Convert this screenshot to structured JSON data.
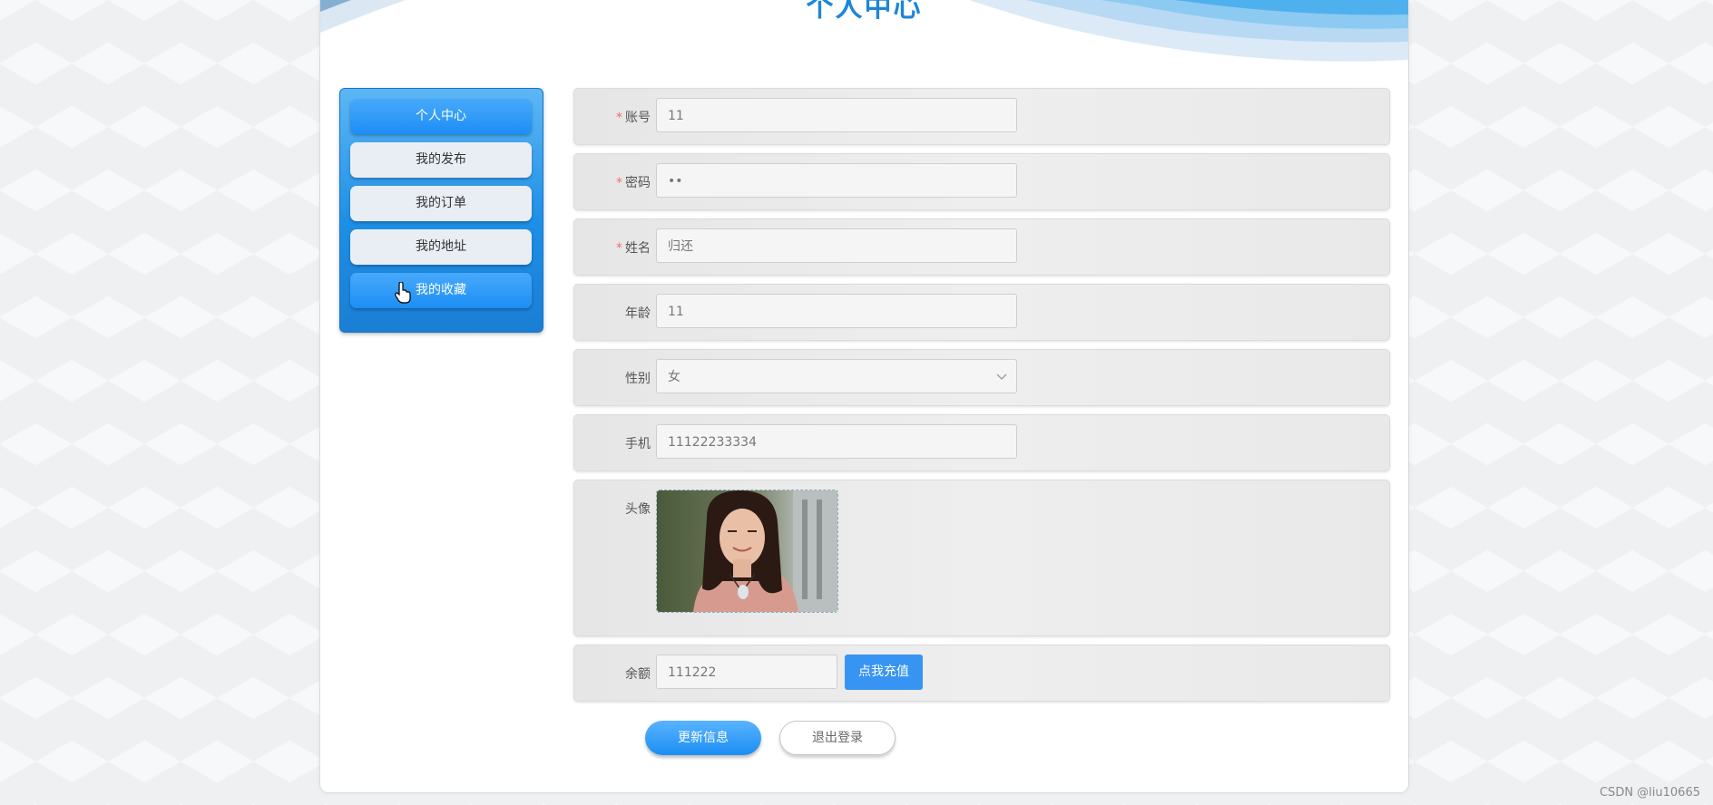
{
  "page": {
    "title": "个人中心",
    "watermark": "CSDN @liu10665"
  },
  "sidebar": {
    "items": [
      {
        "label": "个人中心",
        "active": true
      },
      {
        "label": "我的发布",
        "active": false
      },
      {
        "label": "我的订单",
        "active": false
      },
      {
        "label": "我的地址",
        "active": false
      },
      {
        "label": "我的收藏",
        "active": true
      }
    ]
  },
  "form": {
    "account": {
      "label": "账号",
      "required": "*",
      "value": "11"
    },
    "password": {
      "label": "密码",
      "required": "*",
      "value": "••"
    },
    "name": {
      "label": "姓名",
      "required": "*",
      "value": "归还"
    },
    "age": {
      "label": "年龄",
      "value": "11"
    },
    "gender": {
      "label": "性别",
      "value": "女"
    },
    "phone": {
      "label": "手机",
      "value": "11122233334"
    },
    "avatar": {
      "label": "头像"
    },
    "balance": {
      "label": "余额",
      "value": "111222",
      "recharge_label": "点我充值"
    }
  },
  "actions": {
    "update_label": "更新信息",
    "logout_label": "退出登录"
  },
  "colors": {
    "accent": "#1d8ef5",
    "title": "#1d86d8",
    "required": "#f56c6c"
  }
}
